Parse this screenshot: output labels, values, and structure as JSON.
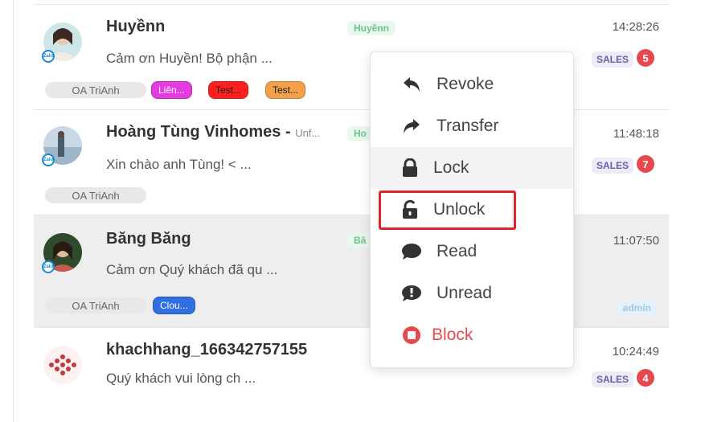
{
  "conversations": [
    {
      "name": "Huyềnn",
      "name_suffix": "",
      "preview": "Cảm ơn Huyền! Bộ phận ...",
      "time": "14:28:26",
      "tag": "Huyềnn",
      "oa": "OA TriAnh",
      "labels": [
        {
          "text": "Liên...",
          "bg": "#e33be0"
        },
        {
          "text": "Test...",
          "bg": "#ff1f1f"
        },
        {
          "text": "Test...",
          "bg": "#f2a04a"
        }
      ],
      "sales": "SALES",
      "count": "5",
      "admin": ""
    },
    {
      "name": "Hoàng Tùng Vinhomes - ",
      "name_suffix": "Unf...",
      "preview": "Xin chào anh Tùng! < ...",
      "time": "11:48:18",
      "tag": "Ho",
      "oa": "OA TriAnh",
      "labels": [],
      "sales": "SALES",
      "count": "7",
      "admin": ""
    },
    {
      "name": "Băng Băng",
      "name_suffix": "",
      "preview": "Cảm ơn Quý khách đã qu ...",
      "time": "11:07:50",
      "tag": "Bă",
      "oa": "OA TriAnh",
      "labels": [
        {
          "text": "Clou...",
          "bg": "#2f6fe0"
        }
      ],
      "sales": "",
      "count": "",
      "admin": "admin"
    },
    {
      "name": "khachhang_166342757155",
      "name_suffix": "",
      "preview": "Quý khách vui lòng ch ...",
      "time": "10:24:49",
      "tag": "",
      "oa": "",
      "labels": [],
      "sales": "SALES",
      "count": "4",
      "admin": ""
    }
  ],
  "menu": {
    "items": [
      {
        "label": "Revoke",
        "icon": "reply-icon"
      },
      {
        "label": "Transfer",
        "icon": "share-icon"
      },
      {
        "label": "Lock",
        "icon": "lock-icon"
      },
      {
        "label": "Unlock",
        "icon": "unlock-icon"
      },
      {
        "label": "Read",
        "icon": "comment-icon"
      },
      {
        "label": "Unread",
        "icon": "comment-exclamation-icon"
      },
      {
        "label": "Block",
        "icon": "block-icon"
      }
    ],
    "hovered": "Lock",
    "highlighted": "Unlock"
  },
  "colors": {
    "danger": "#e5484d",
    "highlight_border": "#e0242b",
    "zalo_blue": "#1a8ad6"
  },
  "zalo_badge_text": "Zalo"
}
